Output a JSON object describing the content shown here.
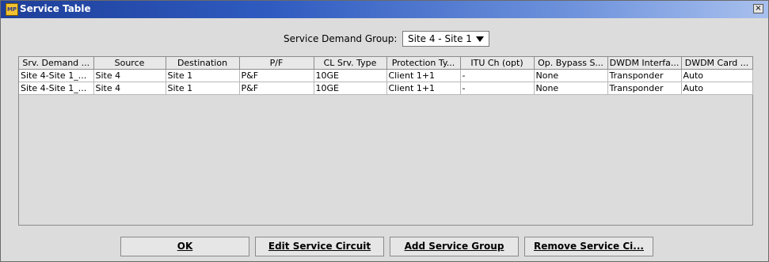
{
  "window": {
    "title": "Service Table",
    "icon": "app-icon",
    "icon_label": "MP",
    "close_label": "×"
  },
  "sdg": {
    "label": "Service Demand Group:",
    "value": "Site 4 - Site 1"
  },
  "table": {
    "columns": [
      "Srv. Demand ...",
      "Source",
      "Destination",
      "P/F",
      "CL Srv. Type",
      "Protection Ty...",
      "ITU Ch (opt)",
      "Op. Bypass S...",
      "DWDM Interfa...",
      "DWDM Card ..."
    ],
    "rows": [
      [
        "Site 4-Site 1_...",
        "Site 4",
        "Site 1",
        "P&F",
        "10GE",
        "Client 1+1",
        "-",
        "None",
        "Transponder",
        "Auto"
      ],
      [
        "Site 4-Site 1_...",
        "Site 4",
        "Site 1",
        "P&F",
        "10GE",
        "Client 1+1",
        "-",
        "None",
        "Transponder",
        "Auto"
      ]
    ]
  },
  "buttons": {
    "ok": "OK",
    "edit": "Edit Service Circuit",
    "add": "Add Service Group",
    "remove": "Remove Service Ci..."
  }
}
